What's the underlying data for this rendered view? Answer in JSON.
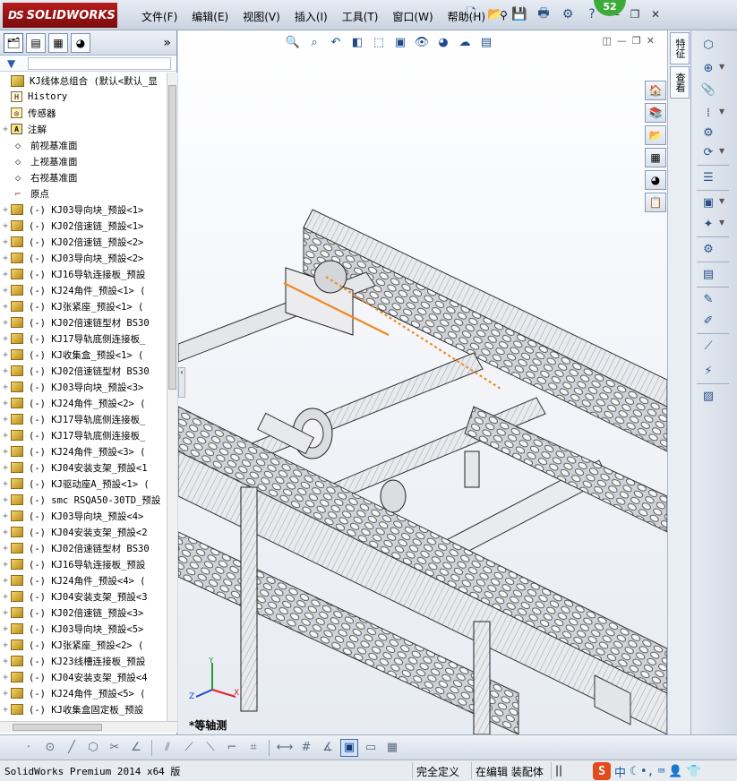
{
  "app": {
    "logo_ds": "DS",
    "logo_text": "SOLIDWORKS",
    "notification_count": "52"
  },
  "menu": [
    "文件(F)",
    "编辑(E)",
    "视图(V)",
    "插入(I)",
    "工具(T)",
    "窗口(W)",
    "帮助(H)"
  ],
  "top_help": "?",
  "featuretree": {
    "expand_label": "»",
    "root": "KJ线体总组合  (默认<默认_显",
    "items": [
      {
        "label": "History",
        "icon": "history-icon",
        "expand": ""
      },
      {
        "label": "传感器",
        "icon": "sensor-icon",
        "expand": ""
      },
      {
        "label": "注解",
        "icon": "annotation-icon",
        "expand": "+"
      },
      {
        "label": "前视基准面",
        "icon": "plane-icon",
        "expand": ""
      },
      {
        "label": "上视基准面",
        "icon": "plane-icon",
        "expand": ""
      },
      {
        "label": "右视基准面",
        "icon": "plane-icon",
        "expand": ""
      },
      {
        "label": "原点",
        "icon": "origin-icon",
        "expand": ""
      },
      {
        "label": "(-) KJ03导向块_预設<1>",
        "icon": "part-icon",
        "expand": "+"
      },
      {
        "label": "(-) KJ02倍速链_预設<1>",
        "icon": "part-icon",
        "expand": "+"
      },
      {
        "label": "(-) KJ02倍速链_预設<2>",
        "icon": "part-icon",
        "expand": "+"
      },
      {
        "label": "(-) KJ03导向块_预設<2>",
        "icon": "part-icon",
        "expand": "+"
      },
      {
        "label": "(-) KJ16导轨连接板_预設",
        "icon": "part-icon",
        "expand": "+"
      },
      {
        "label": "(-) KJ24角件_预設<1> (",
        "icon": "part-icon",
        "expand": "+"
      },
      {
        "label": "(-) KJ张紧座_预設<1> (",
        "icon": "part-icon",
        "expand": "+"
      },
      {
        "label": "(-) KJ02倍速链型材 BS30",
        "icon": "part-icon",
        "expand": "+"
      },
      {
        "label": "(-) KJ17导轨底侧连接板_",
        "icon": "part-icon",
        "expand": "+"
      },
      {
        "label": "(-) KJ收集盒_预設<1> (",
        "icon": "part-icon",
        "expand": "+"
      },
      {
        "label": "(-) KJ02倍速链型材 BS30",
        "icon": "part-icon",
        "expand": "+"
      },
      {
        "label": "(-) KJ03导向块_预設<3>",
        "icon": "part-icon",
        "expand": "+"
      },
      {
        "label": "(-) KJ24角件_预設<2> (",
        "icon": "part-icon",
        "expand": "+"
      },
      {
        "label": "(-) KJ17导轨底侧连接板_",
        "icon": "part-icon",
        "expand": "+"
      },
      {
        "label": "(-) KJ17导轨底侧连接板_",
        "icon": "part-icon",
        "expand": "+"
      },
      {
        "label": "(-) KJ24角件_预設<3> (",
        "icon": "part-icon",
        "expand": "+"
      },
      {
        "label": "(-) KJ04安装支架_预設<1",
        "icon": "part-icon",
        "expand": "+"
      },
      {
        "label": "(-) KJ驱动座A_预設<1> (",
        "icon": "part-icon",
        "expand": "+"
      },
      {
        "label": "(-) smc RSQA50-30TD_预設",
        "icon": "part-icon",
        "expand": "+"
      },
      {
        "label": "(-) KJ03导向块_预設<4>",
        "icon": "part-icon",
        "expand": "+"
      },
      {
        "label": "(-) KJ04安装支架_预設<2",
        "icon": "part-icon",
        "expand": "+"
      },
      {
        "label": "(-) KJ02倍速链型材 BS30",
        "icon": "part-icon",
        "expand": "+"
      },
      {
        "label": "(-) KJ16导轨连接板_预設",
        "icon": "part-icon",
        "expand": "+"
      },
      {
        "label": "(-) KJ24角件_预設<4> (",
        "icon": "part-icon",
        "expand": "+"
      },
      {
        "label": "(-) KJ04安装支架_预設<3",
        "icon": "part-icon",
        "expand": "+"
      },
      {
        "label": "(-) KJ02倍速链_预設<3>",
        "icon": "part-icon",
        "expand": "+"
      },
      {
        "label": "(-) KJ03导向块_预設<5>",
        "icon": "part-icon",
        "expand": "+"
      },
      {
        "label": "(-) KJ张紧座_预設<2> (",
        "icon": "part-icon",
        "expand": "+"
      },
      {
        "label": "(-) KJ23线槽连接板_预設",
        "icon": "part-icon",
        "expand": "+"
      },
      {
        "label": "(-) KJ04安装支架_预設<4",
        "icon": "part-icon",
        "expand": "+"
      },
      {
        "label": "(-) KJ24角件_预設<5> (",
        "icon": "part-icon",
        "expand": "+"
      },
      {
        "label": "(-) KJ收集盒固定板_预設",
        "icon": "part-icon",
        "expand": "+"
      }
    ]
  },
  "viewport": {
    "view_label": "*等轴测",
    "triad": {
      "x": "X",
      "y": "Y",
      "z": "Z"
    }
  },
  "taskpane": {
    "tab1": "特征",
    "tab2": "查看"
  },
  "statusbar": {
    "version": "SolidWorks Premium 2014 x64 版",
    "definition": "完全定义",
    "mode": "在编辑 装配体",
    "ime_brand": "S",
    "ime_lang": "中"
  },
  "colors": {
    "accent": "#b71b1b",
    "highlight": "#f08a24"
  }
}
